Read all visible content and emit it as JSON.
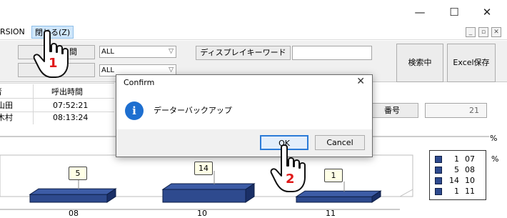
{
  "window": {
    "min_glyph": "—",
    "max_glyph": "☐",
    "close_glyph": "✕"
  },
  "menubar": {
    "items": [
      {
        "label": "RSION"
      },
      {
        "label": "閉じる(Z)"
      }
    ],
    "mdi_min": "_",
    "mdi_restore": "▫",
    "mdi_close": "✕"
  },
  "search": {
    "partial_button_label": "間",
    "combo1_value": "ALL",
    "combo2_value": "ALL",
    "keyword_button_label": "ディスプレイキーワード",
    "keyword_input_value": "",
    "search_button_label": "検索中",
    "excel_button_label": "Excel保存"
  },
  "grid": {
    "headers": [
      "者",
      "呼出時間"
    ],
    "rows": [
      [
        "山田",
        "07:52:21"
      ],
      [
        "木村",
        "08:13:24"
      ]
    ],
    "number_button_label": "番号",
    "number_value": "21"
  },
  "dialog": {
    "title": "Confirm",
    "close_glyph": "✕",
    "icon_glyph": "i",
    "message": "データーバックアップ",
    "ok_label": "OK",
    "cancel_label": "Cancel"
  },
  "annotations": {
    "step1": "1",
    "step2": "2"
  },
  "chart_data": {
    "type": "bar",
    "categories": [
      "08",
      "10",
      "11"
    ],
    "values": [
      5,
      14,
      1
    ],
    "data_labels": [
      "5",
      "14",
      "1"
    ],
    "percent_marks": [
      "%",
      "%"
    ],
    "legend": [
      {
        "count": "1",
        "label": "07"
      },
      {
        "count": "5",
        "label": "08"
      },
      {
        "count": "14",
        "label": "10"
      },
      {
        "count": "1",
        "label": "11"
      }
    ],
    "colors": {
      "bar": "#2e4a8e",
      "bar_dark": "#1a2f66",
      "bar_top": "#3d5ca6"
    }
  }
}
